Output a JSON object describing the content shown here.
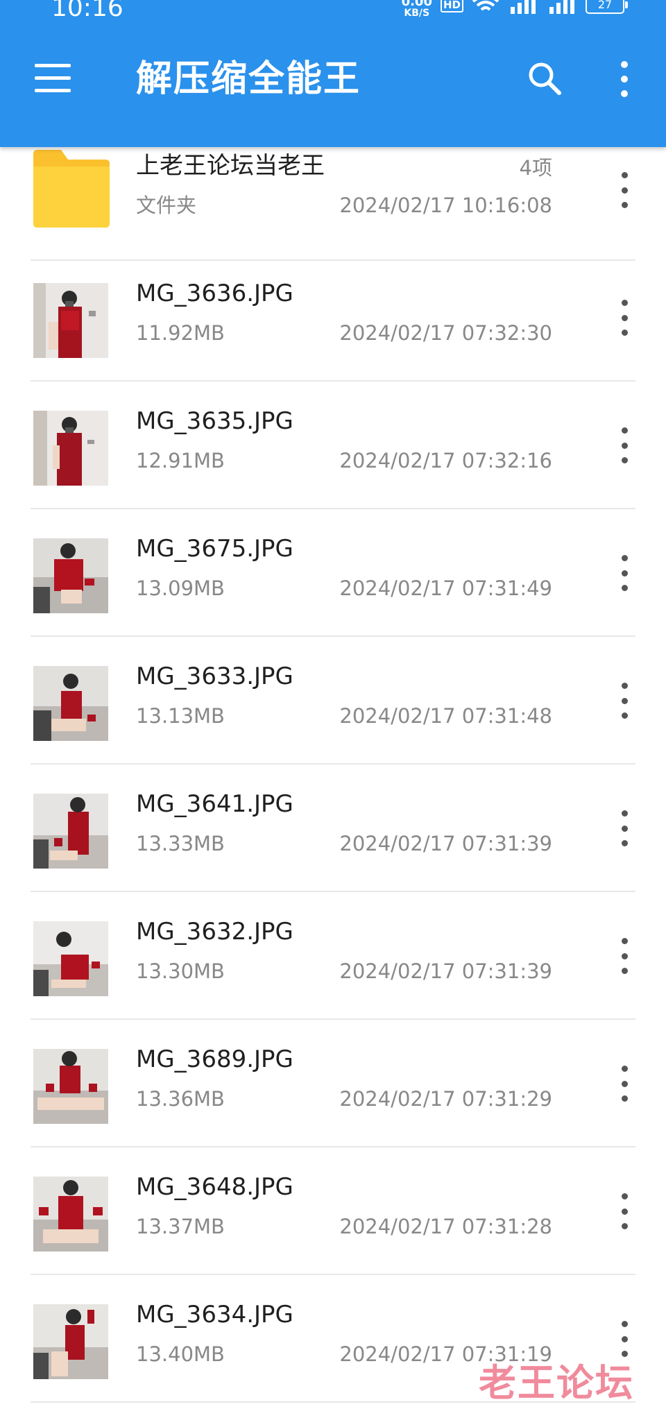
{
  "status_bar": {
    "time": "10:16",
    "net_speed_value": "0.00",
    "net_speed_unit": "KB/S",
    "hd_label": "HD",
    "battery": "27"
  },
  "app_bar": {
    "title": "解压缩全能王",
    "menu_icon": "hamburger-menu-icon",
    "search_icon": "search-icon",
    "more_icon": "more-vert-icon",
    "color": "#2a91ec"
  },
  "folder": {
    "name": "上老王论坛当老王",
    "type_label": "文件夹",
    "item_count": "4项",
    "date": "2024/02/17 10:16:08"
  },
  "files": [
    {
      "name": "MG_3636.JPG",
      "size": "11.92MB",
      "date": "2024/02/17 07:32:30"
    },
    {
      "name": "MG_3635.JPG",
      "size": "12.91MB",
      "date": "2024/02/17 07:32:16"
    },
    {
      "name": "MG_3675.JPG",
      "size": "13.09MB",
      "date": "2024/02/17 07:31:49"
    },
    {
      "name": "MG_3633.JPG",
      "size": "13.13MB",
      "date": "2024/02/17 07:31:48"
    },
    {
      "name": "MG_3641.JPG",
      "size": "13.33MB",
      "date": "2024/02/17 07:31:39"
    },
    {
      "name": "MG_3632.JPG",
      "size": "13.30MB",
      "date": "2024/02/17 07:31:39"
    },
    {
      "name": "MG_3689.JPG",
      "size": "13.36MB",
      "date": "2024/02/17 07:31:29"
    },
    {
      "name": "MG_3648.JPG",
      "size": "13.37MB",
      "date": "2024/02/17 07:31:28"
    },
    {
      "name": "MG_3634.JPG",
      "size": "13.40MB",
      "date": "2024/02/17 07:31:19"
    }
  ],
  "watermark": "老王论坛"
}
